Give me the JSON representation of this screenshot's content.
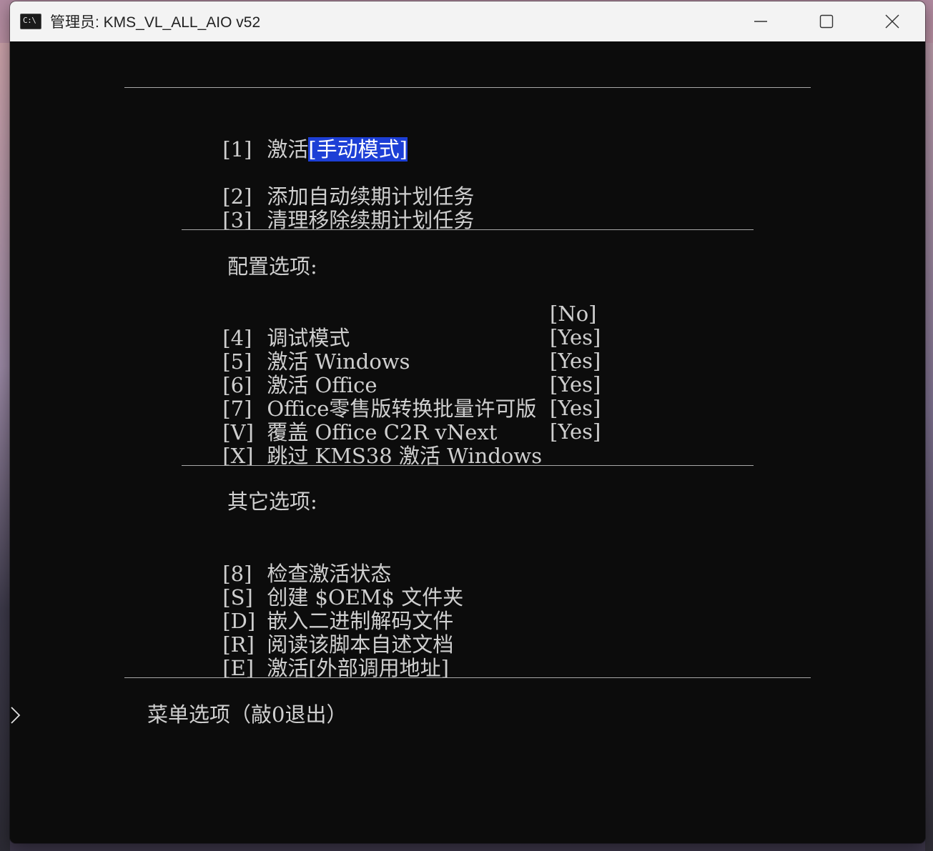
{
  "window": {
    "icon_text": "C:\\",
    "title": "管理员:  KMS_VL_ALL_AIO v52"
  },
  "menu": {
    "item1": {
      "key": "[1]",
      "label": "激活",
      "highlight": "[手动模式]"
    },
    "item2": {
      "key": "[2]",
      "label": "添加自动续期计划任务"
    },
    "item3": {
      "key": "[3]",
      "label": "清理移除续期计划任务"
    },
    "config_header": "配置选项:",
    "config": [
      {
        "key": "[4]",
        "label": "调试模式",
        "value": "[No]"
      },
      {
        "key": "[5]",
        "label": "激活 Windows",
        "value": "[Yes]"
      },
      {
        "key": "[6]",
        "label": "激活 Office",
        "value": "[Yes]"
      },
      {
        "key": "[7]",
        "label": "Office零售版转换批量许可版",
        "value": "[Yes]"
      },
      {
        "key": "[V]",
        "label": "覆盖 Office C2R vNext",
        "value": "[Yes]"
      },
      {
        "key": "[X]",
        "label": "跳过 KMS38 激活 Windows",
        "value": "[Yes]"
      }
    ],
    "other_header": "其它选项:",
    "other": [
      {
        "key": "[8]",
        "label": "检查激活状态"
      },
      {
        "key": "[S]",
        "label": "创建 $OEM$ 文件夹"
      },
      {
        "key": "[D]",
        "label": "嵌入二进制解码文件"
      },
      {
        "key": "[R]",
        "label": "阅读该脚本自述文档"
      },
      {
        "key": "[E]",
        "label": "激活[外部调用地址]"
      }
    ],
    "prompt": "菜单选项（敲0退出）"
  },
  "colors": {
    "console_bg": "#0c0c0c",
    "console_fg": "#cccccc",
    "highlight_bg": "#1d3fd6",
    "titlebar_bg": "#f3f3f3"
  }
}
